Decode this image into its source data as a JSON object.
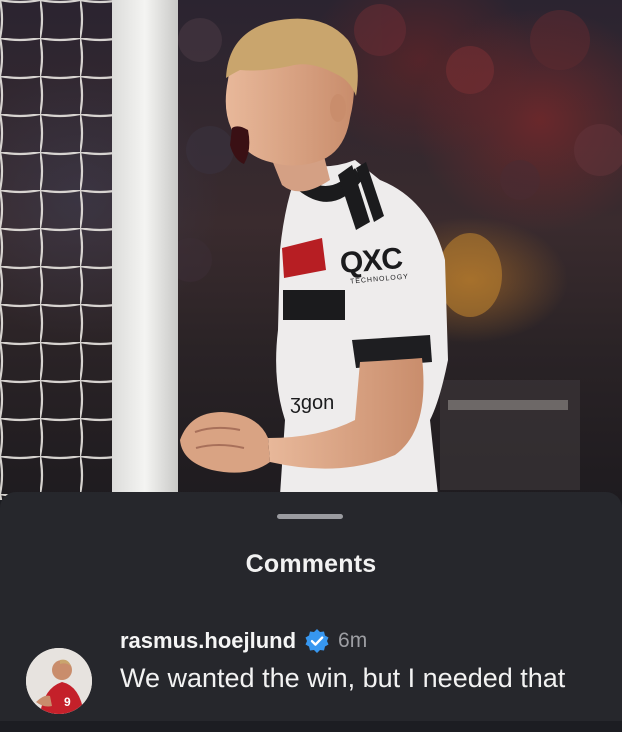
{
  "post": {
    "photo_description_icon": "celebration-photo",
    "jersey_sponsor": "QXC",
    "jersey_sponsor_sub": "TECHNOLOGY",
    "shirt_text": "ʒgon"
  },
  "sheet": {
    "title": "Comments"
  },
  "comment": {
    "username": "rasmus.hoejlund",
    "verified_icon": "verified-badge-icon",
    "time": "6m",
    "text": "We wanted the win, but I needed that",
    "avatar_number": "9"
  },
  "colors": {
    "sheet_bg": "#26272c",
    "verified_blue": "#3797f0",
    "text_primary": "#f2f2f2",
    "text_secondary": "#9d9ea3"
  }
}
